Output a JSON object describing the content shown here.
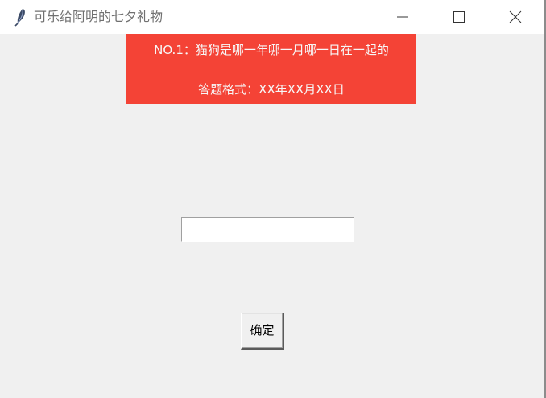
{
  "window": {
    "title": "可乐给阿明的七夕礼物",
    "icon": "feather-icon",
    "controls": [
      "minimize-icon",
      "maximize-icon",
      "close-icon"
    ]
  },
  "question": {
    "line1": "NO.1：猫狗是哪一年哪一月哪一日在一起的",
    "line2": "答题格式：XX年XX月XX日",
    "background_color": "#f44336"
  },
  "answer": {
    "value": "",
    "placeholder": ""
  },
  "confirm": {
    "label": "确定"
  }
}
